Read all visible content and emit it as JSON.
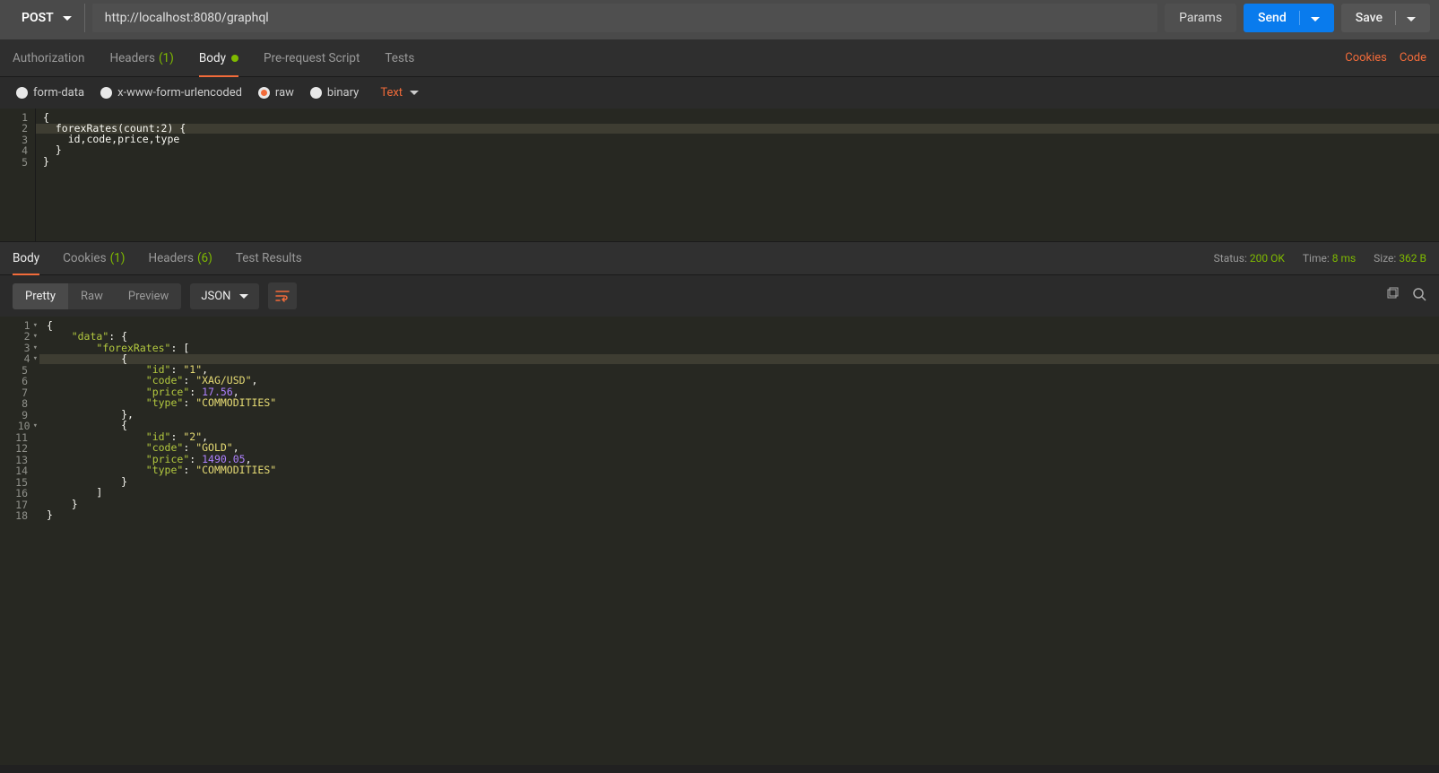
{
  "request": {
    "method": "POST",
    "url": "http://localhost:8080/graphql",
    "params_label": "Params",
    "send_label": "Send",
    "save_label": "Save"
  },
  "req_tabs": {
    "authorization": "Authorization",
    "headers": "Headers",
    "headers_count": "(1)",
    "body": "Body",
    "prereq": "Pre-request Script",
    "tests": "Tests",
    "cookies_link": "Cookies",
    "code_link": "Code"
  },
  "body_types": {
    "form_data": "form-data",
    "urlencoded": "x-www-form-urlencoded",
    "raw": "raw",
    "binary": "binary",
    "text_label": "Text"
  },
  "req_body_lines": [
    "{",
    "  forexRates(count:2) {",
    "    id,code,price,type",
    "  }",
    "}"
  ],
  "resp_tabs": {
    "body": "Body",
    "cookies": "Cookies",
    "cookies_count": "(1)",
    "headers": "Headers",
    "headers_count": "(6)",
    "test_results": "Test Results"
  },
  "status": {
    "status_label": "Status:",
    "status_value": "200 OK",
    "time_label": "Time:",
    "time_value": "8 ms",
    "size_label": "Size:",
    "size_value": "362 B"
  },
  "view_modes": {
    "pretty": "Pretty",
    "raw": "Raw",
    "preview": "Preview",
    "format": "JSON"
  },
  "resp_lines": [
    {
      "n": "1",
      "f": "▾",
      "t": [
        {
          "c": "punct",
          "v": "{"
        }
      ]
    },
    {
      "n": "2",
      "f": "▾",
      "t": [
        {
          "c": "punct",
          "v": "    "
        },
        {
          "c": "key",
          "v": "\"data\""
        },
        {
          "c": "punct",
          "v": ": {"
        }
      ]
    },
    {
      "n": "3",
      "f": "▾",
      "t": [
        {
          "c": "punct",
          "v": "        "
        },
        {
          "c": "key",
          "v": "\"forexRates\""
        },
        {
          "c": "punct",
          "v": ": ["
        }
      ]
    },
    {
      "n": "4",
      "f": "▾",
      "hl": true,
      "t": [
        {
          "c": "punct",
          "v": "            {"
        }
      ]
    },
    {
      "n": "5",
      "f": "",
      "t": [
        {
          "c": "punct",
          "v": "                "
        },
        {
          "c": "key",
          "v": "\"id\""
        },
        {
          "c": "punct",
          "v": ": "
        },
        {
          "c": "str",
          "v": "\"1\""
        },
        {
          "c": "punct",
          "v": ","
        }
      ]
    },
    {
      "n": "6",
      "f": "",
      "t": [
        {
          "c": "punct",
          "v": "                "
        },
        {
          "c": "key",
          "v": "\"code\""
        },
        {
          "c": "punct",
          "v": ": "
        },
        {
          "c": "str",
          "v": "\"XAG/USD\""
        },
        {
          "c": "punct",
          "v": ","
        }
      ]
    },
    {
      "n": "7",
      "f": "",
      "t": [
        {
          "c": "punct",
          "v": "                "
        },
        {
          "c": "key",
          "v": "\"price\""
        },
        {
          "c": "punct",
          "v": ": "
        },
        {
          "c": "num",
          "v": "17.56"
        },
        {
          "c": "punct",
          "v": ","
        }
      ]
    },
    {
      "n": "8",
      "f": "",
      "t": [
        {
          "c": "punct",
          "v": "                "
        },
        {
          "c": "key",
          "v": "\"type\""
        },
        {
          "c": "punct",
          "v": ": "
        },
        {
          "c": "str",
          "v": "\"COMMODITIES\""
        }
      ]
    },
    {
      "n": "9",
      "f": "",
      "t": [
        {
          "c": "punct",
          "v": "            },"
        }
      ]
    },
    {
      "n": "10",
      "f": "▾",
      "t": [
        {
          "c": "punct",
          "v": "            {"
        }
      ]
    },
    {
      "n": "11",
      "f": "",
      "t": [
        {
          "c": "punct",
          "v": "                "
        },
        {
          "c": "key",
          "v": "\"id\""
        },
        {
          "c": "punct",
          "v": ": "
        },
        {
          "c": "str",
          "v": "\"2\""
        },
        {
          "c": "punct",
          "v": ","
        }
      ]
    },
    {
      "n": "12",
      "f": "",
      "t": [
        {
          "c": "punct",
          "v": "                "
        },
        {
          "c": "key",
          "v": "\"code\""
        },
        {
          "c": "punct",
          "v": ": "
        },
        {
          "c": "str",
          "v": "\"GOLD\""
        },
        {
          "c": "punct",
          "v": ","
        }
      ]
    },
    {
      "n": "13",
      "f": "",
      "t": [
        {
          "c": "punct",
          "v": "                "
        },
        {
          "c": "key",
          "v": "\"price\""
        },
        {
          "c": "punct",
          "v": ": "
        },
        {
          "c": "num",
          "v": "1490.05"
        },
        {
          "c": "punct",
          "v": ","
        }
      ]
    },
    {
      "n": "14",
      "f": "",
      "t": [
        {
          "c": "punct",
          "v": "                "
        },
        {
          "c": "key",
          "v": "\"type\""
        },
        {
          "c": "punct",
          "v": ": "
        },
        {
          "c": "str",
          "v": "\"COMMODITIES\""
        }
      ]
    },
    {
      "n": "15",
      "f": "",
      "t": [
        {
          "c": "punct",
          "v": "            }"
        }
      ]
    },
    {
      "n": "16",
      "f": "",
      "t": [
        {
          "c": "punct",
          "v": "        ]"
        }
      ]
    },
    {
      "n": "17",
      "f": "",
      "t": [
        {
          "c": "punct",
          "v": "    }"
        }
      ]
    },
    {
      "n": "18",
      "f": "",
      "t": [
        {
          "c": "punct",
          "v": "}"
        }
      ]
    }
  ]
}
